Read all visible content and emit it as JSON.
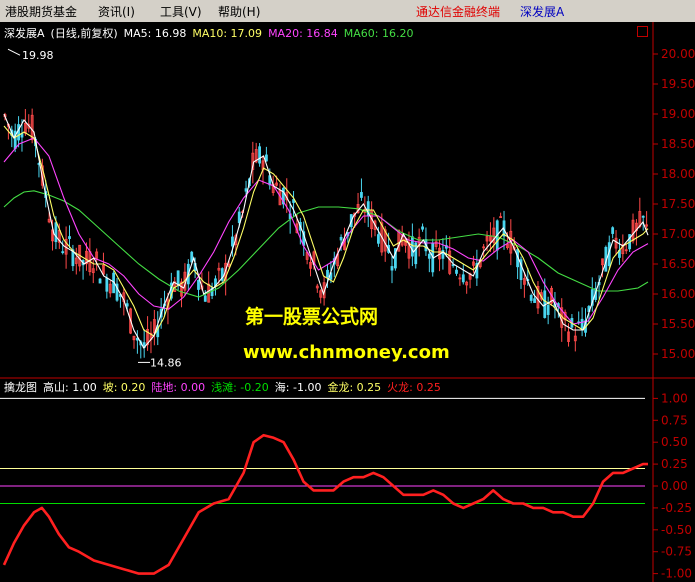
{
  "menu": {
    "items": [
      "港股期货基金",
      "资讯(I)",
      "工具(V)",
      "帮助(H)"
    ],
    "app_title": "通达信金融终端",
    "stock_name": "深发展A"
  },
  "colors": {
    "bg": "#000000",
    "axis": "#c00000",
    "up": "#ff4a4a",
    "down": "#4ad6f0",
    "ma5": "#ffffff",
    "ma10": "#ffff66",
    "ma20": "#ff44ff",
    "ma60": "#44dd44",
    "line_high": "#ffffff",
    "line_slope": "#ffff99",
    "line_land": "#ff44ff",
    "line_shoal": "#00dd00",
    "fire_dragon": "#ff2020"
  },
  "price_header": [
    {
      "text": "深发展A",
      "color": "#ffffff"
    },
    {
      "text": "(日线,前复权)",
      "color": "#ffffff"
    },
    {
      "text": "MA5: 16.98",
      "color": "#ffffff"
    },
    {
      "text": "MA10: 17.09",
      "color": "#ffff66"
    },
    {
      "text": "MA20: 16.84",
      "color": "#ff44ff"
    },
    {
      "text": "MA60: 16.20",
      "color": "#44dd44"
    }
  ],
  "indicator_header": [
    {
      "text": "擒龙图",
      "color": "#ffffff"
    },
    {
      "text": "高山: 1.00",
      "color": "#ffffff"
    },
    {
      "text": "坡: 0.20",
      "color": "#ffff66"
    },
    {
      "text": "陆地: 0.00",
      "color": "#ff44ff"
    },
    {
      "text": "浅滩: -0.20",
      "color": "#00dd00"
    },
    {
      "text": "海: -1.00",
      "color": "#ffffff"
    },
    {
      "text": "金龙: 0.25",
      "color": "#ffff66"
    },
    {
      "text": "火龙: 0.25",
      "color": "#ff2020"
    }
  ],
  "watermark": {
    "line1": "第一股票公式网",
    "line2": "www.chnmoney.com",
    "color": "#ffff00"
  },
  "chart_data": [
    {
      "type": "line",
      "name": "price",
      "ylim": [
        14.7,
        20.2
      ],
      "yticks": [
        "20.00",
        "19.50",
        "19.00",
        "18.50",
        "18.00",
        "17.50",
        "17.00",
        "16.50",
        "16.00",
        "15.50",
        "15.00"
      ],
      "annotations": [
        {
          "text": "19.98",
          "value": 19.98
        },
        {
          "text": "14.86",
          "value": 14.86
        }
      ],
      "series": [
        {
          "name": "MA60",
          "x": [
            0,
            10,
            20,
            30,
            45,
            60,
            75,
            95,
            115,
            135,
            155,
            175,
            195,
            215,
            235,
            255,
            275,
            295,
            315,
            335,
            355,
            375,
            395,
            415,
            435,
            455,
            475,
            495,
            515,
            535,
            555,
            575,
            595,
            615,
            635,
            645
          ],
          "y": [
            17.45,
            17.6,
            17.7,
            17.72,
            17.65,
            17.55,
            17.4,
            17.1,
            16.8,
            16.5,
            16.25,
            16.05,
            15.95,
            16.1,
            16.4,
            16.75,
            17.1,
            17.35,
            17.45,
            17.45,
            17.42,
            17.3,
            17.05,
            16.9,
            16.9,
            16.95,
            17.0,
            16.95,
            16.8,
            16.6,
            16.35,
            16.2,
            16.05,
            16.05,
            16.1,
            16.2
          ]
        },
        {
          "name": "MA20",
          "x": [
            0,
            15,
            30,
            45,
            60,
            75,
            90,
            105,
            120,
            135,
            150,
            165,
            180,
            195,
            210,
            225,
            240,
            255,
            270,
            285,
            300,
            315,
            330,
            345,
            360,
            375,
            390,
            405,
            420,
            435,
            450,
            465,
            480,
            495,
            510,
            525,
            540,
            555,
            570,
            585,
            600,
            615,
            630,
            645
          ],
          "y": [
            18.2,
            18.5,
            18.6,
            18.3,
            17.6,
            17.0,
            16.6,
            16.5,
            16.3,
            16.0,
            15.8,
            15.75,
            15.95,
            16.3,
            16.7,
            17.2,
            17.6,
            17.9,
            17.8,
            17.4,
            16.8,
            16.4,
            16.55,
            17.0,
            17.3,
            17.3,
            17.1,
            16.9,
            16.85,
            16.85,
            16.75,
            16.6,
            16.55,
            16.75,
            16.9,
            16.7,
            16.2,
            15.8,
            15.5,
            15.55,
            15.95,
            16.4,
            16.7,
            16.84
          ]
        },
        {
          "name": "MA10",
          "x": [
            0,
            10,
            20,
            30,
            40,
            50,
            60,
            70,
            80,
            90,
            100,
            110,
            120,
            130,
            140,
            150,
            160,
            170,
            180,
            190,
            200,
            210,
            220,
            230,
            240,
            250,
            260,
            270,
            280,
            290,
            300,
            310,
            320,
            330,
            340,
            350,
            360,
            370,
            380,
            390,
            400,
            410,
            420,
            430,
            440,
            450,
            460,
            470,
            480,
            490,
            500,
            510,
            520,
            530,
            540,
            550,
            560,
            570,
            580,
            590,
            600,
            610,
            620,
            630,
            640,
            645
          ],
          "y": [
            18.8,
            18.6,
            18.7,
            18.6,
            18.0,
            17.3,
            16.9,
            16.7,
            16.6,
            16.5,
            16.5,
            16.4,
            16.1,
            15.8,
            15.4,
            15.3,
            15.6,
            16.1,
            16.2,
            16.4,
            16.2,
            16.1,
            16.2,
            16.6,
            17.1,
            17.7,
            18.1,
            18.0,
            17.8,
            17.6,
            17.3,
            16.8,
            16.3,
            16.2,
            16.6,
            17.1,
            17.4,
            17.4,
            17.1,
            16.8,
            16.9,
            16.8,
            16.8,
            16.7,
            16.7,
            16.6,
            16.5,
            16.4,
            16.6,
            16.8,
            17.0,
            16.9,
            16.6,
            16.2,
            15.9,
            15.8,
            15.6,
            15.5,
            15.4,
            15.6,
            16.1,
            16.6,
            16.8,
            16.9,
            17.0,
            17.09
          ]
        },
        {
          "name": "MA5",
          "x": [
            0,
            10,
            20,
            30,
            40,
            50,
            60,
            70,
            80,
            90,
            100,
            110,
            120,
            130,
            140,
            150,
            160,
            170,
            180,
            190,
            200,
            210,
            220,
            230,
            240,
            250,
            260,
            270,
            280,
            290,
            300,
            310,
            320,
            330,
            340,
            350,
            360,
            370,
            380,
            390,
            400,
            410,
            420,
            430,
            440,
            450,
            460,
            470,
            480,
            490,
            500,
            510,
            520,
            530,
            540,
            550,
            560,
            570,
            580,
            590,
            600,
            610,
            620,
            630,
            640,
            645
          ],
          "y": [
            19.0,
            18.6,
            18.9,
            18.7,
            17.8,
            17.0,
            16.8,
            16.7,
            16.5,
            16.6,
            16.3,
            16.2,
            15.9,
            15.4,
            15.1,
            15.3,
            15.8,
            16.2,
            16.1,
            16.6,
            16.0,
            16.1,
            16.3,
            16.8,
            17.4,
            18.2,
            18.3,
            17.8,
            17.7,
            17.4,
            17.0,
            16.5,
            16.0,
            16.5,
            16.9,
            17.3,
            17.5,
            17.2,
            16.9,
            16.6,
            17.0,
            16.7,
            16.9,
            16.6,
            16.7,
            16.5,
            16.4,
            16.3,
            16.7,
            16.9,
            17.1,
            16.8,
            16.4,
            16.0,
            15.8,
            15.9,
            15.5,
            15.4,
            15.4,
            15.9,
            16.4,
            16.9,
            16.8,
            17.0,
            17.2,
            16.98
          ]
        }
      ]
    },
    {
      "type": "line",
      "name": "擒龙图",
      "ylim": [
        -1.05,
        1.05
      ],
      "yticks": [
        "1.00",
        "0.75",
        "0.50",
        "0.25",
        "0.00",
        "-0.25",
        "-0.50",
        "-0.75",
        "-1.00"
      ],
      "reference_lines": [
        {
          "name": "高山",
          "value": 1.0
        },
        {
          "name": "坡",
          "value": 0.2
        },
        {
          "name": "陆地",
          "value": 0.0
        },
        {
          "name": "浅滩",
          "value": -0.2
        }
      ],
      "series": [
        {
          "name": "火龙",
          "x": [
            0,
            10,
            20,
            30,
            38,
            45,
            55,
            65,
            75,
            90,
            105,
            120,
            135,
            150,
            165,
            180,
            195,
            210,
            225,
            240,
            250,
            260,
            270,
            280,
            290,
            300,
            310,
            320,
            330,
            340,
            350,
            360,
            370,
            380,
            390,
            400,
            410,
            420,
            430,
            440,
            450,
            460,
            470,
            480,
            490,
            500,
            510,
            520,
            530,
            540,
            550,
            560,
            570,
            580,
            590,
            600,
            610,
            620,
            630,
            640,
            645
          ],
          "y": [
            -0.9,
            -0.65,
            -0.45,
            -0.3,
            -0.25,
            -0.35,
            -0.55,
            -0.7,
            -0.75,
            -0.85,
            -0.9,
            -0.95,
            -1.0,
            -1.0,
            -0.9,
            -0.6,
            -0.3,
            -0.2,
            -0.15,
            0.15,
            0.5,
            0.58,
            0.55,
            0.5,
            0.3,
            0.05,
            -0.05,
            -0.05,
            -0.05,
            0.05,
            0.1,
            0.1,
            0.15,
            0.1,
            0.0,
            -0.1,
            -0.1,
            -0.1,
            -0.05,
            -0.1,
            -0.2,
            -0.25,
            -0.2,
            -0.15,
            -0.05,
            -0.15,
            -0.2,
            -0.2,
            -0.25,
            -0.25,
            -0.3,
            -0.3,
            -0.35,
            -0.35,
            -0.2,
            0.05,
            0.15,
            0.15,
            0.2,
            0.25,
            0.25
          ]
        }
      ]
    }
  ]
}
